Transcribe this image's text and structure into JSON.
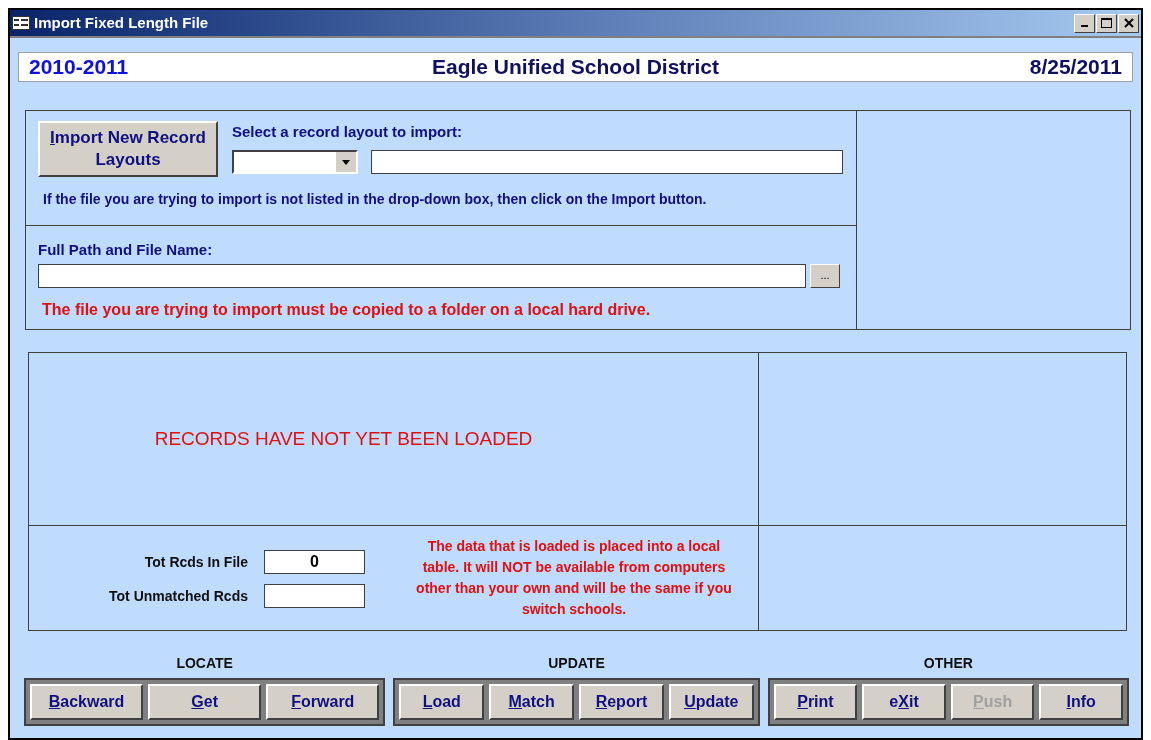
{
  "window": {
    "title": "Import Fixed Length File"
  },
  "header": {
    "year": "2010-2011",
    "district": "Eagle Unified School District",
    "date": "8/25/2011"
  },
  "import_section": {
    "import_button": {
      "key": "I",
      "after": "mport New Record Layouts"
    },
    "select_label": "Select a record layout to import:",
    "hint": "If the file you are trying to import is not listed in the drop-down box, then click on the Import button."
  },
  "path_section": {
    "label": "Full Path and File Name:",
    "browse_button": "...",
    "warning": "The file you are trying to import must be copied to a folder on a local hard drive."
  },
  "status": "RECORDS HAVE NOT YET BEEN LOADED",
  "totals": [
    {
      "label": "Tot Rcds In File",
      "value": "0"
    },
    {
      "label": "Tot Unmatched Rcds"
    }
  ],
  "note": "The data that is loaded is placed into a local table.  It will NOT be available from computers other than your own and will be the same if you switch schools.",
  "groups": [
    {
      "title": "LOCATE",
      "buttons": [
        {
          "label": {
            "key": "B",
            "after": "ackward"
          },
          "disabled": false
        },
        {
          "label": {
            "key": "G",
            "after": "et"
          },
          "disabled": false
        },
        {
          "label": {
            "key": "F",
            "after": "orward"
          },
          "disabled": false
        }
      ]
    },
    {
      "title": "UPDATE",
      "buttons": [
        {
          "label": {
            "key": "L",
            "after": "oad"
          },
          "disabled": false
        },
        {
          "label": {
            "key": "M",
            "after": "atch"
          },
          "disabled": false
        },
        {
          "label": {
            "key": "R",
            "after": "eport"
          },
          "disabled": false
        },
        {
          "label": {
            "key": "U",
            "after": "pdate"
          },
          "disabled": false
        }
      ]
    },
    {
      "title": "OTHER",
      "buttons": [
        {
          "label": {
            "key": "P",
            "after": "rint"
          },
          "disabled": false
        },
        {
          "label": {
            "before": "e",
            "key": "X",
            "after": "it"
          },
          "disabled": false
        },
        {
          "label": {
            "key": "P",
            "after": "ush"
          },
          "disabled": true
        },
        {
          "label": {
            "key": "I",
            "after": "nfo"
          },
          "disabled": false
        }
      ]
    }
  ]
}
